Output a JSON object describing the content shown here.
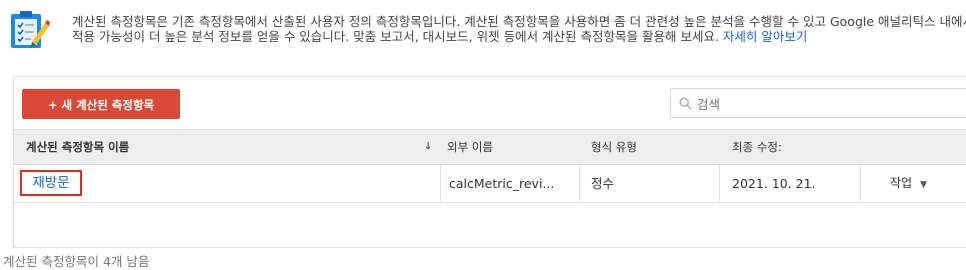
{
  "info": {
    "text": "계산된 측정항목은 기존 측정항목에서 산출된 사용자 정의 측정항목입니다. 계산된 측정항목을 사용하면 좀 더 관련성 높은 분석을 수행할 수 있고 Google 애널리틱스 내에서 적용 가능성이 더 높은 분석 정보를 얻을 수 있습니다. 맞춤 보고서, 대시보드, 위젯 등에서 계산된 측정항목을 활용해 보세요. ",
    "link": "자세히 알아보기",
    "icon": "checklist-edit-icon"
  },
  "toolbar": {
    "new_button": "+ 새 계산된 측정항목",
    "search_placeholder": "검색",
    "search_icon": "search-icon"
  },
  "table": {
    "columns": [
      "계산된 측정항목 이름",
      "외부 이름",
      "형식 유형",
      "최종 수정:"
    ],
    "sort_indicator": "↓",
    "rows": [
      {
        "name": "재방문",
        "external_name": "calcMetric_revi...",
        "format": "정수",
        "modified": "2021. 10. 21.",
        "action": "작업",
        "action_caret": "▼"
      }
    ]
  },
  "footer": {
    "remaining": "계산된 측정항목이 4개 남음"
  },
  "colors": {
    "accent": "#d84a36",
    "link": "#1a66c9",
    "highlight_border": "#d93025"
  }
}
